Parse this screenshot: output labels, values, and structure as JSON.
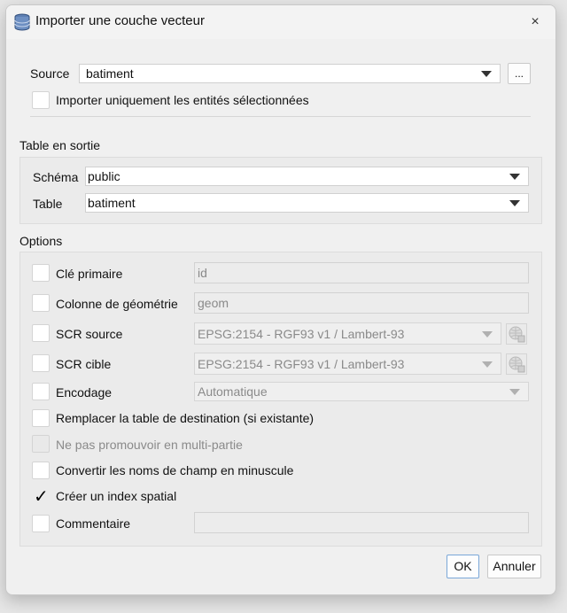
{
  "window": {
    "title": "Importer une couche vecteur",
    "close": "×"
  },
  "source": {
    "label": "Source",
    "value": "batiment",
    "browse_label": "...",
    "only_selected_label": "Importer uniquement les entités sélectionnées",
    "only_selected_checked": false
  },
  "output": {
    "section_label": "Table en sortie",
    "schema_label": "Schéma",
    "schema_value": "public",
    "table_label": "Table",
    "table_value": "batiment"
  },
  "options": {
    "section_label": "Options",
    "primary_key": {
      "label": "Clé primaire",
      "value": "id",
      "checked": false
    },
    "geometry_column": {
      "label": "Colonne de géométrie",
      "value": "geom",
      "checked": false
    },
    "source_crs": {
      "label": "SCR source",
      "value": "EPSG:2154 - RGF93 v1 / Lambert-93",
      "checked": false
    },
    "target_crs": {
      "label": "SCR cible",
      "value": "EPSG:2154 - RGF93 v1 / Lambert-93",
      "checked": false
    },
    "encoding": {
      "label": "Encodage",
      "value": "Automatique",
      "checked": false
    },
    "replace_table": {
      "label": "Remplacer la table de destination (si existante)",
      "checked": false
    },
    "no_multipart": {
      "label": "Ne pas promouvoir en multi-partie",
      "checked": false,
      "disabled": true
    },
    "lowercase_fields": {
      "label": "Convertir les noms de champ en minuscule",
      "checked": false
    },
    "spatial_index": {
      "label": "Créer un index spatial",
      "checked": true,
      "mark": "✓"
    },
    "comment": {
      "label": "Commentaire",
      "value": "",
      "checked": false
    }
  },
  "buttons": {
    "ok": "OK",
    "cancel": "Annuler"
  },
  "colors": {
    "accent": "#7aa7d8",
    "dialog_bg": "#f0f0f0"
  }
}
